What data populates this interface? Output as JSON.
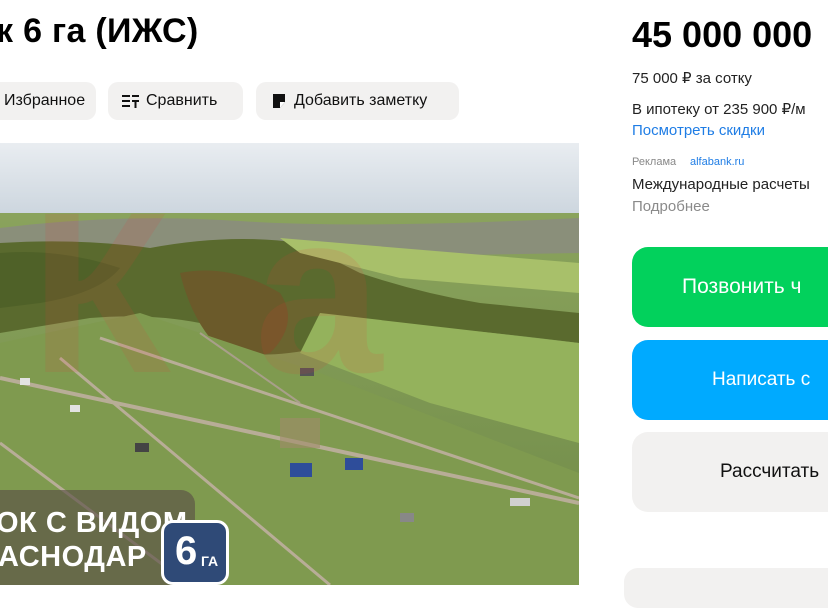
{
  "listing": {
    "title": "к 6 га (ИЖС)"
  },
  "actions": {
    "favorite_label": "Избранное",
    "compare_label": "Сравнить",
    "note_label": "Добавить заметку"
  },
  "photo": {
    "overlay_line1": "ОК С ВИДОМ",
    "overlay_line2": "АСНОДАР",
    "area_number": "6",
    "area_unit": "ГА"
  },
  "pricing": {
    "price": "45 000 000",
    "per_sotka": "75 000 ₽ за сотку",
    "mortgage": "В ипотеку от 235 900 ₽/м",
    "discounts_link": "Посмотреть скидки"
  },
  "ad": {
    "label": "Реклама",
    "domain": "alfabank.ru",
    "title": "Международные расчеты",
    "more": "Подробнее"
  },
  "cta": {
    "call": "Позвонить ч",
    "write": "Написать с",
    "calculate": "Рассчитать"
  },
  "colors": {
    "call_bg": "#02d15c",
    "write_bg": "#00aaff",
    "link": "#1f7de5",
    "button_bg": "#f2f1f0"
  }
}
